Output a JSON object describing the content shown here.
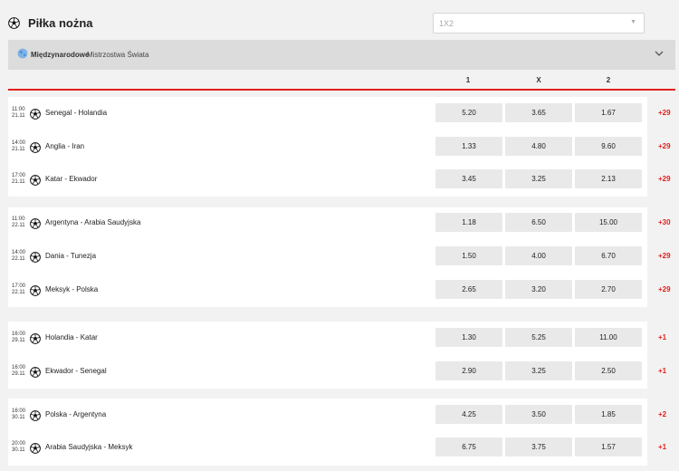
{
  "header": {
    "title": "Piłka nożna",
    "market_select": {
      "value": "1X2"
    }
  },
  "league": {
    "country": "Międzynarodowe",
    "name": "Mistrzostwa Świata"
  },
  "columns": [
    "1",
    "X",
    "2"
  ],
  "matches": [
    {
      "time": "11:00",
      "date": "21.11",
      "name": "Senegal - Holandia",
      "odds": [
        "5.20",
        "3.65",
        "1.67"
      ],
      "more": "+29"
    },
    {
      "time": "14:00",
      "date": "21.11",
      "name": "Anglia - Iran",
      "odds": [
        "1.33",
        "4.80",
        "9.60"
      ],
      "more": "+29"
    },
    {
      "time": "17:00",
      "date": "21.11",
      "name": "Katar - Ekwador",
      "odds": [
        "3.45",
        "3.25",
        "2.13"
      ],
      "more": "+29"
    },
    {
      "time": "11:00",
      "date": "22.11",
      "name": "Argentyna - Arabia Saudyjska",
      "odds": [
        "1.18",
        "6.50",
        "15.00"
      ],
      "more": "+30"
    },
    {
      "time": "14:00",
      "date": "22.11",
      "name": "Dania - Tunezja",
      "odds": [
        "1.50",
        "4.00",
        "6.70"
      ],
      "more": "+29"
    },
    {
      "time": "17:00",
      "date": "22.11",
      "name": "Meksyk - Polska",
      "odds": [
        "2.65",
        "3.20",
        "2.70"
      ],
      "more": "+29"
    },
    {
      "time": "16:00",
      "date": "29.11",
      "name": "Holandia - Katar",
      "odds": [
        "1.30",
        "5.25",
        "11.00"
      ],
      "more": "+1"
    },
    {
      "time": "16:00",
      "date": "29.11",
      "name": "Ekwador - Senegal",
      "odds": [
        "2.90",
        "3.25",
        "2.50"
      ],
      "more": "+1"
    },
    {
      "time": "16:00",
      "date": "30.11",
      "name": "Polska - Argentyna",
      "odds": [
        "4.25",
        "3.50",
        "1.85"
      ],
      "more": "+2"
    },
    {
      "time": "20:00",
      "date": "30.11",
      "name": "Arabia Saudyjska - Meksyk",
      "odds": [
        "6.75",
        "3.75",
        "1.57"
      ],
      "more": "+1"
    }
  ],
  "colors": {
    "accent": "#e2201c",
    "odd_bg": "#e9e9e9",
    "league_bg": "#dcdcdc"
  }
}
